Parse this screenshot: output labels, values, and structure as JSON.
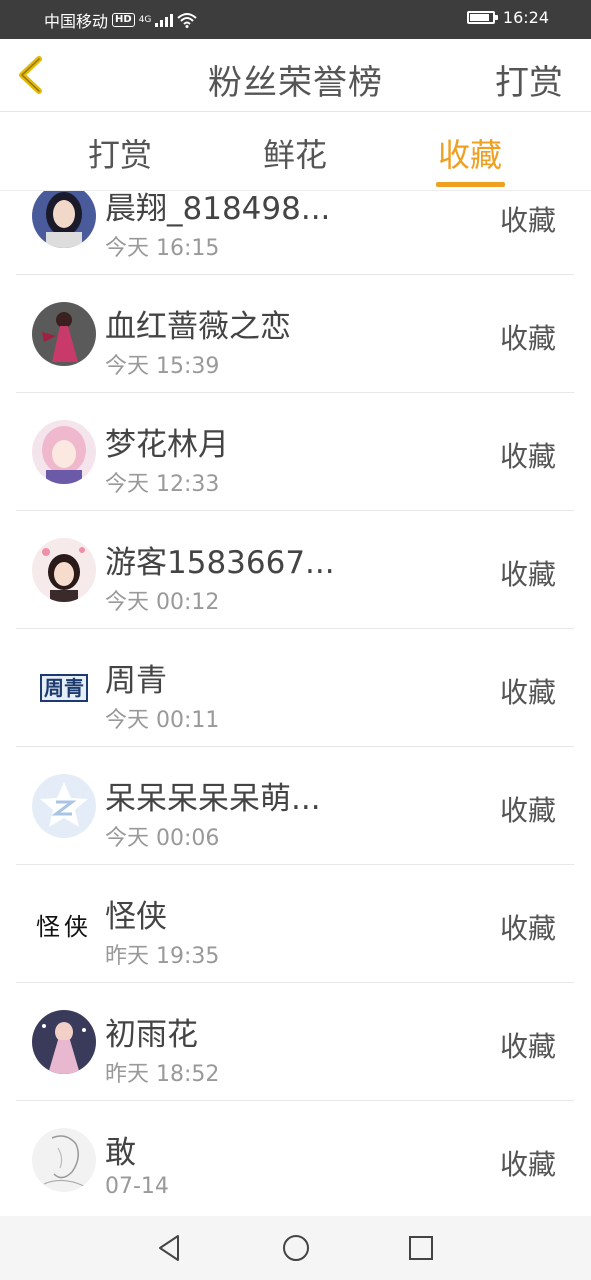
{
  "status_bar": {
    "carrier": "中国移动",
    "hd": "HD",
    "network": "4G",
    "time": "16:24"
  },
  "header": {
    "title": "粉丝荣誉榜",
    "action_label": "打赏",
    "back_icon": "chevron-left-icon"
  },
  "tabs": [
    {
      "label": "打赏",
      "active": false
    },
    {
      "label": "鲜花",
      "active": false
    },
    {
      "label": "收藏",
      "active": true
    }
  ],
  "accent_color": "#f0a020",
  "list": [
    {
      "name": "晨翔_818498...",
      "time": "今天 16:15",
      "action": "收藏",
      "avatar": "avatar-woman-dark-hair-icon"
    },
    {
      "name": "血红蔷薇之恋",
      "time": "今天 15:39",
      "action": "收藏",
      "avatar": "avatar-pink-dress-icon"
    },
    {
      "name": "梦花林月",
      "time": "今天 12:33",
      "action": "收藏",
      "avatar": "avatar-anime-girl-icon"
    },
    {
      "name": "游客1583667...",
      "time": "今天 00:12",
      "action": "收藏",
      "avatar": "avatar-girl-hearts-icon"
    },
    {
      "name": "周青",
      "time": "今天 00:11",
      "action": "收藏",
      "avatar": "avatar-text-zhouqing-icon",
      "avatar_text": "周青"
    },
    {
      "name": "呆呆呆呆呆萌...",
      "time": "今天 00:06",
      "action": "收藏",
      "avatar": "avatar-default-star-icon"
    },
    {
      "name": "怪侠",
      "time": "昨天 19:35",
      "action": "收藏",
      "avatar": "avatar-calligraphy-icon",
      "avatar_text": "怪侠"
    },
    {
      "name": "初雨花",
      "time": "昨天 18:52",
      "action": "收藏",
      "avatar": "avatar-princess-icon"
    },
    {
      "name": "敢",
      "time": "07-14",
      "action": "收藏",
      "avatar": "avatar-sketch-icon"
    }
  ]
}
